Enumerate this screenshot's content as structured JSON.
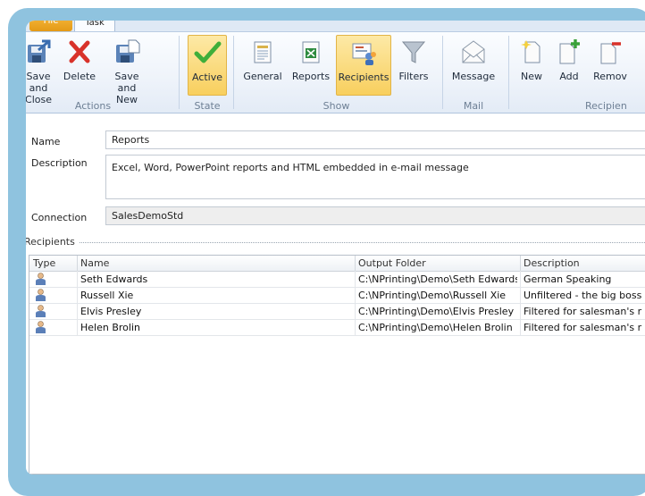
{
  "ribbon": {
    "tabs": {
      "file": "File",
      "task": "Task"
    },
    "buttons": {
      "save_close": "Save and Close",
      "delete": "Delete",
      "save_new": "Save and New",
      "active": "Active",
      "general": "General",
      "reports": "Reports",
      "recipients": "Recipients",
      "filters": "Filters",
      "message": "Message",
      "new": "New",
      "add": "Add",
      "remove": "Remov"
    },
    "groups": {
      "actions": "Actions",
      "state": "State",
      "show": "Show",
      "mail": "Mail",
      "recipients": "Recipien"
    },
    "icons": [
      "save-icon",
      "delete-icon",
      "save-new-icon",
      "checkmark-icon",
      "document-icon",
      "excel-icon",
      "recipients-icon",
      "filter-icon",
      "envelope-icon",
      "new-document-icon",
      "add-document-icon",
      "remove-document-icon"
    ]
  },
  "form": {
    "name_label": "Name",
    "name_value": "Reports",
    "description_label": "Description",
    "description_value": "Excel, Word, PowerPoint  reports and HTML embedded in e-mail message",
    "connection_label": "Connection",
    "connection_value": "SalesDemoStd"
  },
  "recipients": {
    "section_label": "Recipients",
    "columns": [
      "Type",
      "Name",
      "Output Folder",
      "Description"
    ],
    "rows": [
      {
        "name": "Seth Edwards",
        "folder": "C:\\NPrinting\\Demo\\Seth Edwards",
        "description": "German Speaking"
      },
      {
        "name": "Russell Xie",
        "folder": "C:\\NPrinting\\Demo\\Russell Xie",
        "description": "Unfiltered - the big boss"
      },
      {
        "name": "Elvis Presley",
        "folder": "C:\\NPrinting\\Demo\\Elvis Presley",
        "description": "Filtered for salesman's r"
      },
      {
        "name": "Helen Brolin",
        "folder": "C:\\NPrinting\\Demo\\Helen Brolin",
        "description": "Filtered for salesman's r"
      }
    ]
  },
  "colors": {
    "frame": "#8fc3df",
    "selected": "#f8cf5e",
    "ribbon": "#eef3fa"
  }
}
